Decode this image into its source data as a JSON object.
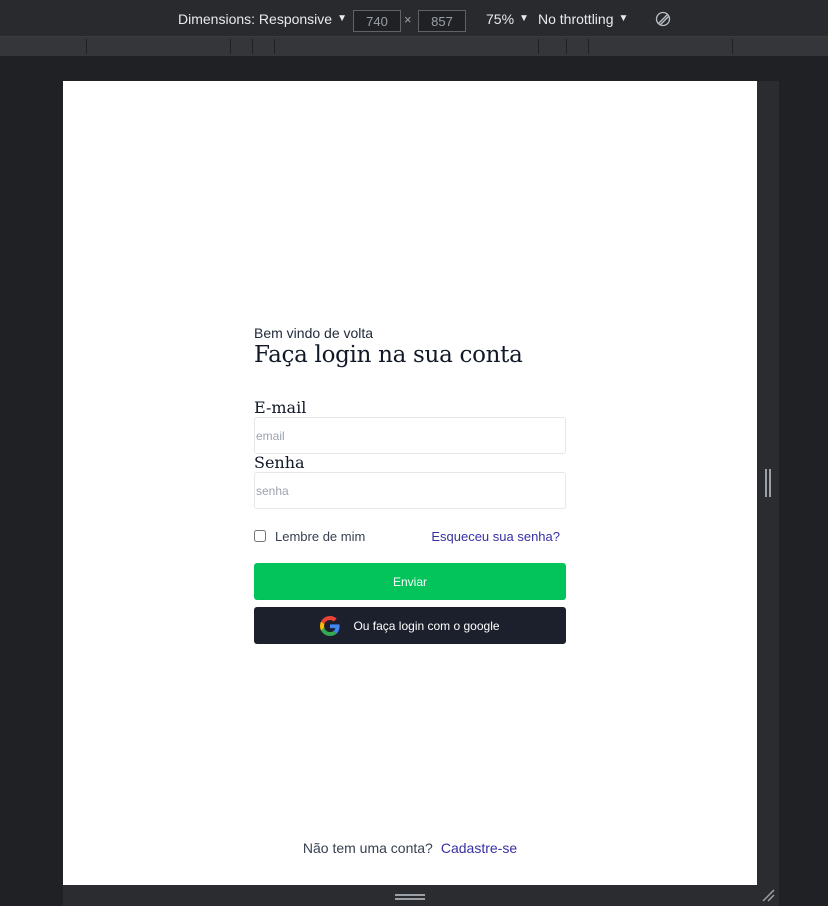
{
  "devtools": {
    "dimensions_label": "Dimensions: Responsive",
    "width_value": "740",
    "height_value": "857",
    "times_symbol": "×",
    "zoom_label": "75%",
    "throttle_label": "No throttling",
    "caret": "▼",
    "icons": {
      "rotate": "rotate-icon",
      "dropdown": "caret-down-icon"
    }
  },
  "login": {
    "welcome": "Bem vindo de volta",
    "heading": "Faça login na sua conta",
    "email_label": "E-mail",
    "email_placeholder": "email",
    "password_label": "Senha",
    "password_placeholder": "senha",
    "remember_label": "Lembre de mim",
    "forgot_link": "Esqueceu sua senha?",
    "submit_label": "Enviar",
    "google_label": "Ou faça login com o google",
    "signup_prompt": "Não tem uma conta?",
    "signup_link": "Cadastre-se"
  },
  "colors": {
    "submit_button": "#03c45a",
    "google_button": "#1b202c",
    "link": "#3730a3",
    "devtools_bg": "#202124"
  }
}
